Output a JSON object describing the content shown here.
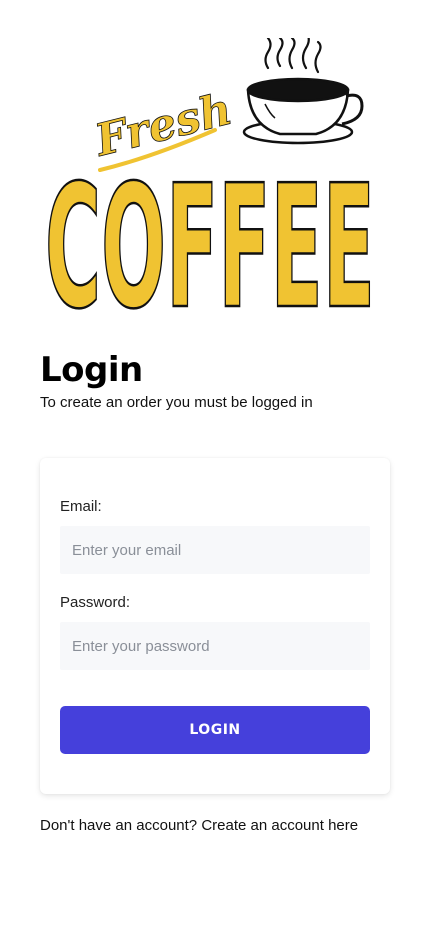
{
  "logo": {
    "script_text": "Fresh",
    "main_text": "COFFEE",
    "brand_color": "#F0C332",
    "icon": "coffee-cup-icon"
  },
  "login": {
    "title": "Login",
    "subtitle": "To create an order you must be logged in"
  },
  "form": {
    "email_label": "Email:",
    "email_placeholder": "Enter your email",
    "password_label": "Password:",
    "password_placeholder": "Enter your password",
    "submit_label": "LOGIN",
    "button_color": "#4540DB"
  },
  "footer": {
    "prompt": "Don't have an account?",
    "link_text": "Create an account here"
  }
}
